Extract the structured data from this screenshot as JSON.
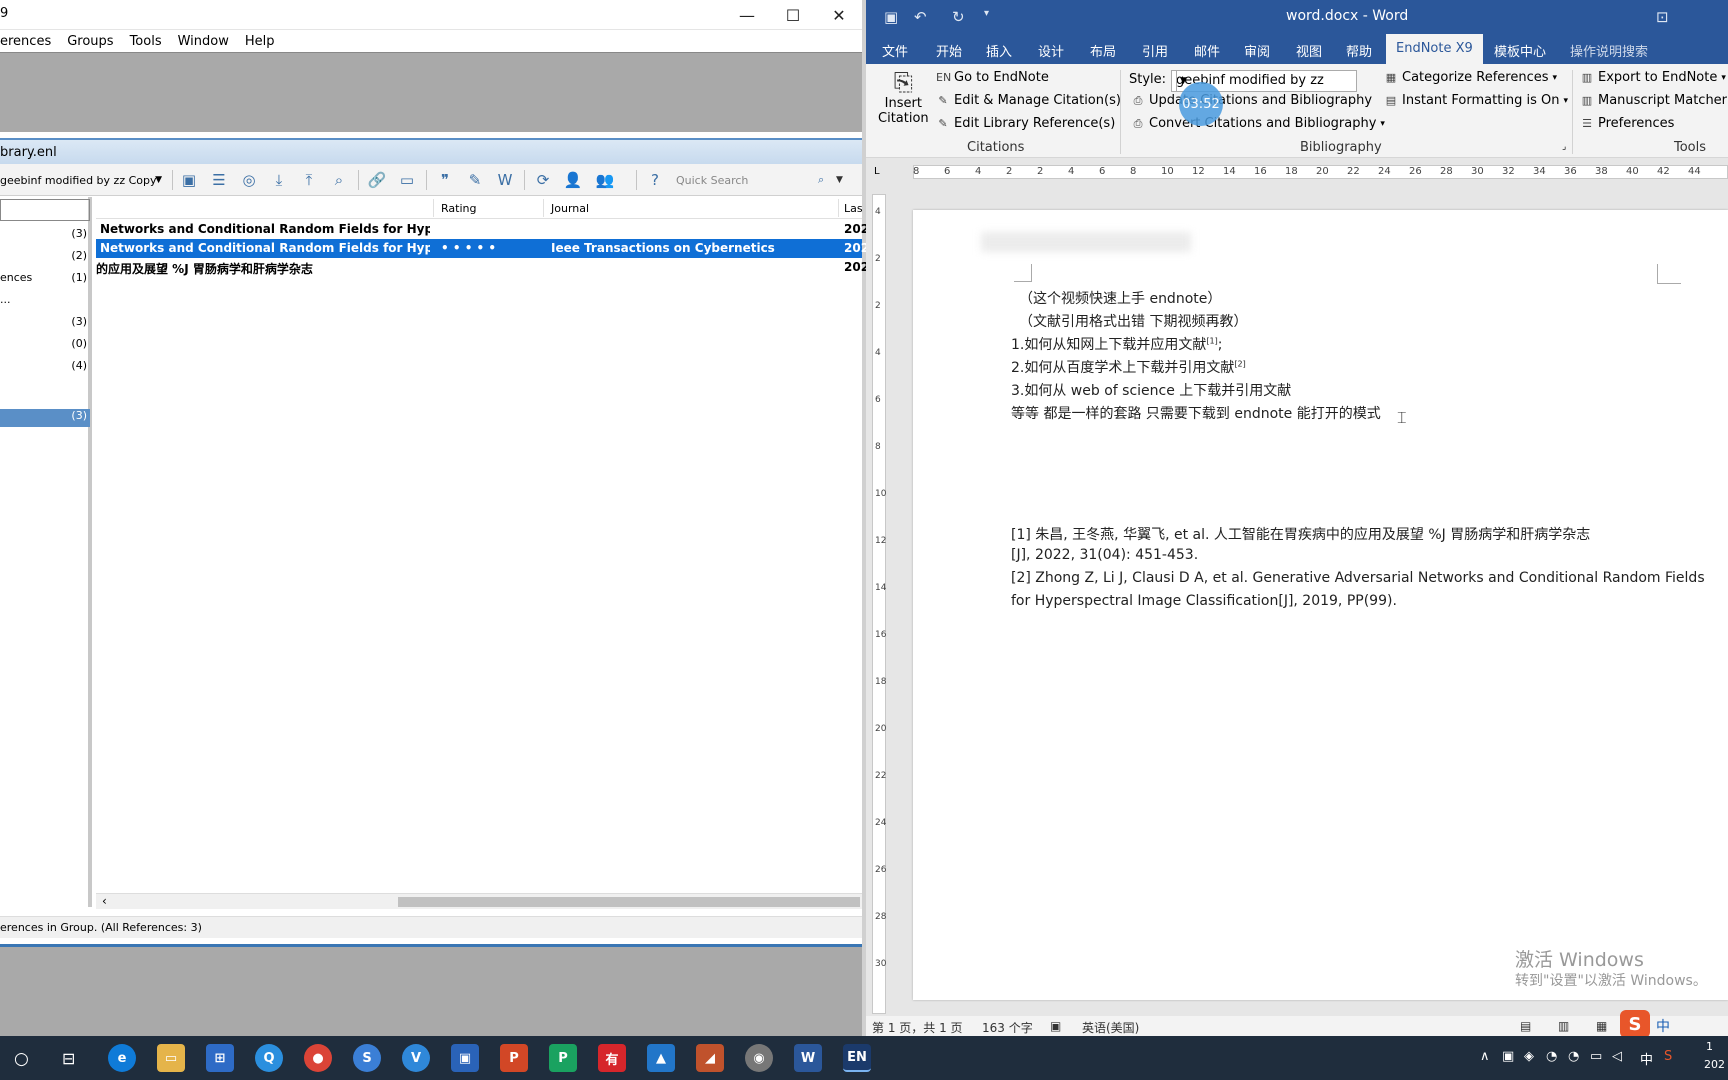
{
  "endnote": {
    "title_fragment": "9",
    "menu": [
      "erences",
      "Groups",
      "Tools",
      "Window",
      "Help"
    ],
    "library_name": "brary.enl",
    "style_selector": "geebinf modified by zz Copy",
    "quick_search_placeholder": "Quick Search",
    "groups": [
      {
        "label": "",
        "count": "(3)"
      },
      {
        "label": "",
        "count": "(2)"
      },
      {
        "label": "ences",
        "count": "(1)"
      },
      {
        "label": "...",
        "count": ""
      },
      {
        "label": "",
        "count": "(3)"
      },
      {
        "label": "",
        "count": "(0)"
      },
      {
        "label": "",
        "count": "(4)"
      },
      {
        "label": "",
        "count": "(3)"
      }
    ],
    "columns": {
      "rating": "Rating",
      "journal": "Journal",
      "last": "Las"
    },
    "references": [
      {
        "title": "Networks and Conditional Random Fields for Hyperspectr...",
        "rating": "",
        "journal": "",
        "year": "202"
      },
      {
        "title": "Networks and Conditional Random Fields for Hyperspectr...",
        "rating": "• • • • •",
        "journal": "Ieee Transactions on Cybernetics",
        "year": "202"
      },
      {
        "title": "的应用及展望 %J 胃肠病学和肝病学杂志",
        "rating": "",
        "journal": "",
        "year": "202"
      }
    ],
    "status": "erences in Group. (All References: 3)"
  },
  "word": {
    "doc_title": "word.docx - Word",
    "tabs": [
      "文件",
      "开始",
      "插入",
      "设计",
      "布局",
      "引用",
      "邮件",
      "审阅",
      "视图",
      "帮助",
      "EndNote X9",
      "模板中心",
      "操作说明搜索"
    ],
    "ribbon": {
      "insert_citation_line1": "Insert",
      "insert_citation_line2": "Citation",
      "go_to_endnote": "Go to EndNote",
      "edit_manage": "Edit & Manage Citation(s)",
      "edit_library": "Edit Library Reference(s)",
      "citations_group": "Citations",
      "style_label": "Style:",
      "style_value": "geebinf modified by zz",
      "update_citations": "Update Citations and Bibliography",
      "convert_citations": "Convert Citations and Bibliography",
      "bibliography_group": "Bibliography",
      "categorize": "Categorize References",
      "instant_formatting": "Instant Formatting is On",
      "export_endnote": "Export to EndNote",
      "manuscript_matcher": "Manuscript Matcher",
      "preferences": "Preferences",
      "tools_group": "Tools",
      "timer": "03:52"
    },
    "ruler_numbers": [
      "8",
      "6",
      "4",
      "2",
      "2",
      "4",
      "6",
      "8",
      "10",
      "12",
      "14",
      "16",
      "18",
      "20",
      "22",
      "24",
      "26",
      "28",
      "30",
      "32",
      "34",
      "36",
      "38",
      "40",
      "42",
      "44"
    ],
    "vruler_numbers": [
      "4",
      "2",
      "2",
      "4",
      "6",
      "8",
      "10",
      "12",
      "14",
      "16",
      "18",
      "20",
      "22",
      "24",
      "26",
      "28",
      "30"
    ],
    "doc": {
      "line1": "（这个视频快速上手 endnote）",
      "line2": "（文献引用格式出错  下期视频再教）",
      "line3": "1.如何从知网上下载并应用文献",
      "line3_sup": "[1]",
      "line3_tail": ";",
      "line4": "2.如何从百度学术上下载并引用文献",
      "line4_sup": "[2]",
      "line5": "3.如何从 web of science  上下载并引用文献",
      "line6": "等等  都是一样的套路  只需要下载到 endnote 能打开的模式",
      "ref1a": "[1]  朱昌, 王冬燕, 华翼飞, et al. 人工智能在胃疾病中的应用及展望 %J 胃肠病学和肝病学杂志",
      "ref1b": "[J], 2022, 31(04): 451-453.",
      "ref2a": "[2] Zhong Z, Li J, Clausi D A, et al. Generative Adversarial Networks and Conditional Random Fields",
      "ref2b": "for Hyperspectral Image Classification[J], 2019, PP(99)."
    },
    "watermark1": "激活 Windows",
    "watermark2": "转到\"设置\"以激活 Windows。",
    "status": {
      "page": "第 1 页，共 1 页",
      "words": "163 个字",
      "lang": "英语(美国)"
    }
  },
  "taskbar": {
    "tray_ime": "中",
    "time_fragment": "1",
    "date_fragment": "202"
  }
}
